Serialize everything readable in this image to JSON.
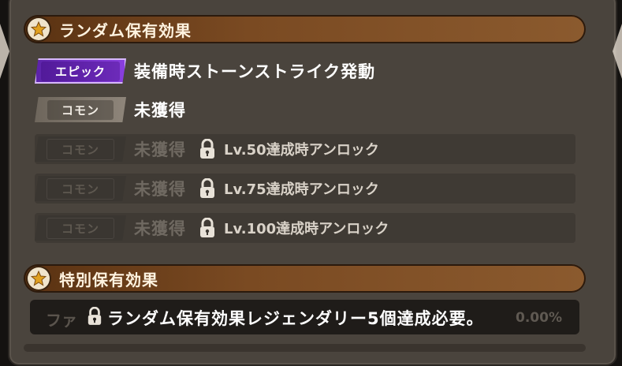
{
  "sections": {
    "random": {
      "title": "ランダム保有効果"
    },
    "special": {
      "title": "特別保有効果"
    }
  },
  "effects": [
    {
      "rarity": "エピック",
      "text": "装備時ストーンストライク発動"
    },
    {
      "rarity": "コモン",
      "text": "未獲得"
    },
    {
      "rarity": "コモン",
      "text": "未獲得",
      "unlock": "Lv.50達成時アンロック"
    },
    {
      "rarity": "コモン",
      "text": "未獲得",
      "unlock": "Lv.75達成時アンロック"
    },
    {
      "rarity": "コモン",
      "text": "未獲得",
      "unlock": "Lv.100達成時アンロック"
    }
  ],
  "special_effect": {
    "background_label": "ファ",
    "requirement": "ランダム保有効果レジェンダリー5個達成必要。",
    "percent": "0.00%"
  },
  "colors": {
    "epic": "#8a3fe0",
    "common": "#8e857a",
    "header": "#7a4a22",
    "panel": "#4a443d"
  },
  "icons": [
    "star-icon",
    "lock-icon"
  ]
}
